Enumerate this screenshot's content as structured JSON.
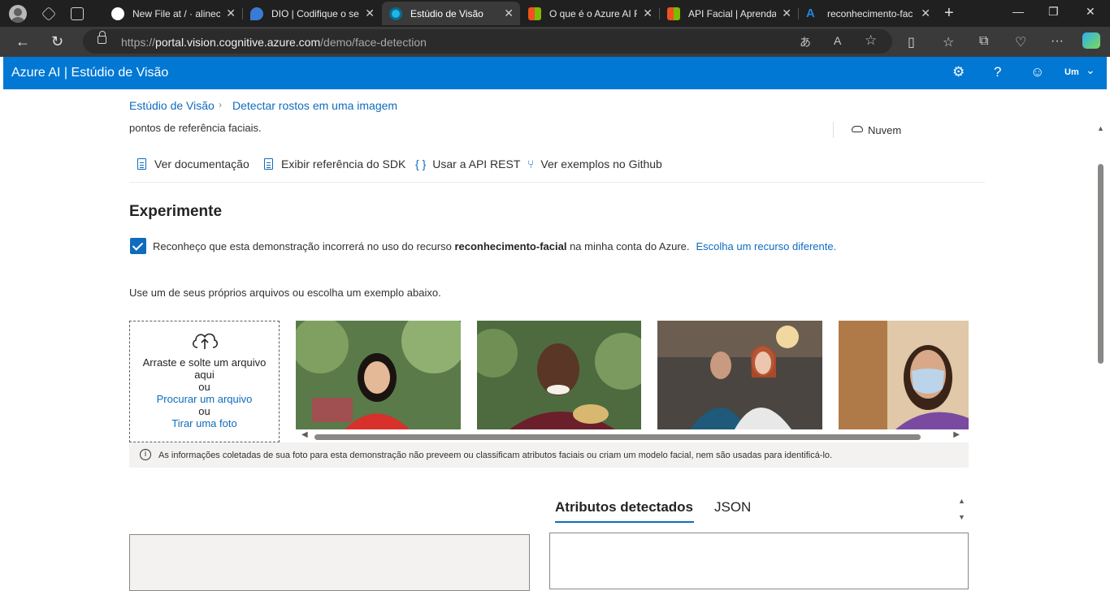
{
  "browser": {
    "tabs": [
      {
        "title": "New File at / · alinec",
        "favicon_color": "#ffffff"
      },
      {
        "title": "DIO | Codifique o se",
        "favicon_color": "#3a7bd5"
      },
      {
        "title": "Estúdio de Visão",
        "favicon_color": "#1fb6e8",
        "active": true
      },
      {
        "title": "O que é o Azure AI F",
        "favicon_color": "#f25022"
      },
      {
        "title": "API Facial | Aprenda",
        "favicon_color": "#f25022"
      },
      {
        "title": "reconhecimento-fac",
        "favicon_color": "#1f85de"
      }
    ],
    "url_prefix": "https://",
    "url_domain": "portal.vision.cognitive.azure.com",
    "url_path": "/demo/face-detection"
  },
  "header": {
    "title": "Azure AI | Estúdio de Visão",
    "user": "Um"
  },
  "breadcrumb": {
    "root": "Estúdio de Visão",
    "current": "Detectar rostos em uma imagem"
  },
  "description": "pontos de referência faciais.",
  "deployment": "Nuvem",
  "links": {
    "docs": "Ver documentação",
    "sdk": "Exibir referência do SDK",
    "rest": "Usar a API REST",
    "github": "Ver exemplos no Github"
  },
  "try_it": {
    "heading": "Experimente",
    "consent_pre": "Reconheço que esta demonstração incorrerá no uso do recurso",
    "consent_resource": "reconhecimento-facial",
    "consent_post": "na minha conta do Azure.",
    "change_resource": "Escolha um recurso diferente.",
    "checked": true,
    "hint": "Use um de seus próprios arquivos ou escolha um exemplo abaixo."
  },
  "upload": {
    "drag_text": "Arraste e solte um arquivo aqui",
    "or1": "ou",
    "browse": "Procurar um arquivo",
    "or2": "ou",
    "photo": "Tirar uma foto"
  },
  "info_text": "As informações coletadas de sua foto para esta demonstração não preveem ou classificam atributos faciais ou criam um modelo facial, nem são usadas para identificá-lo.",
  "result_tabs": {
    "attributes": "Atributos detectados",
    "json": "JSON"
  },
  "colors": {
    "azure_blue": "#0078d4",
    "link": "#0f6cbd"
  }
}
